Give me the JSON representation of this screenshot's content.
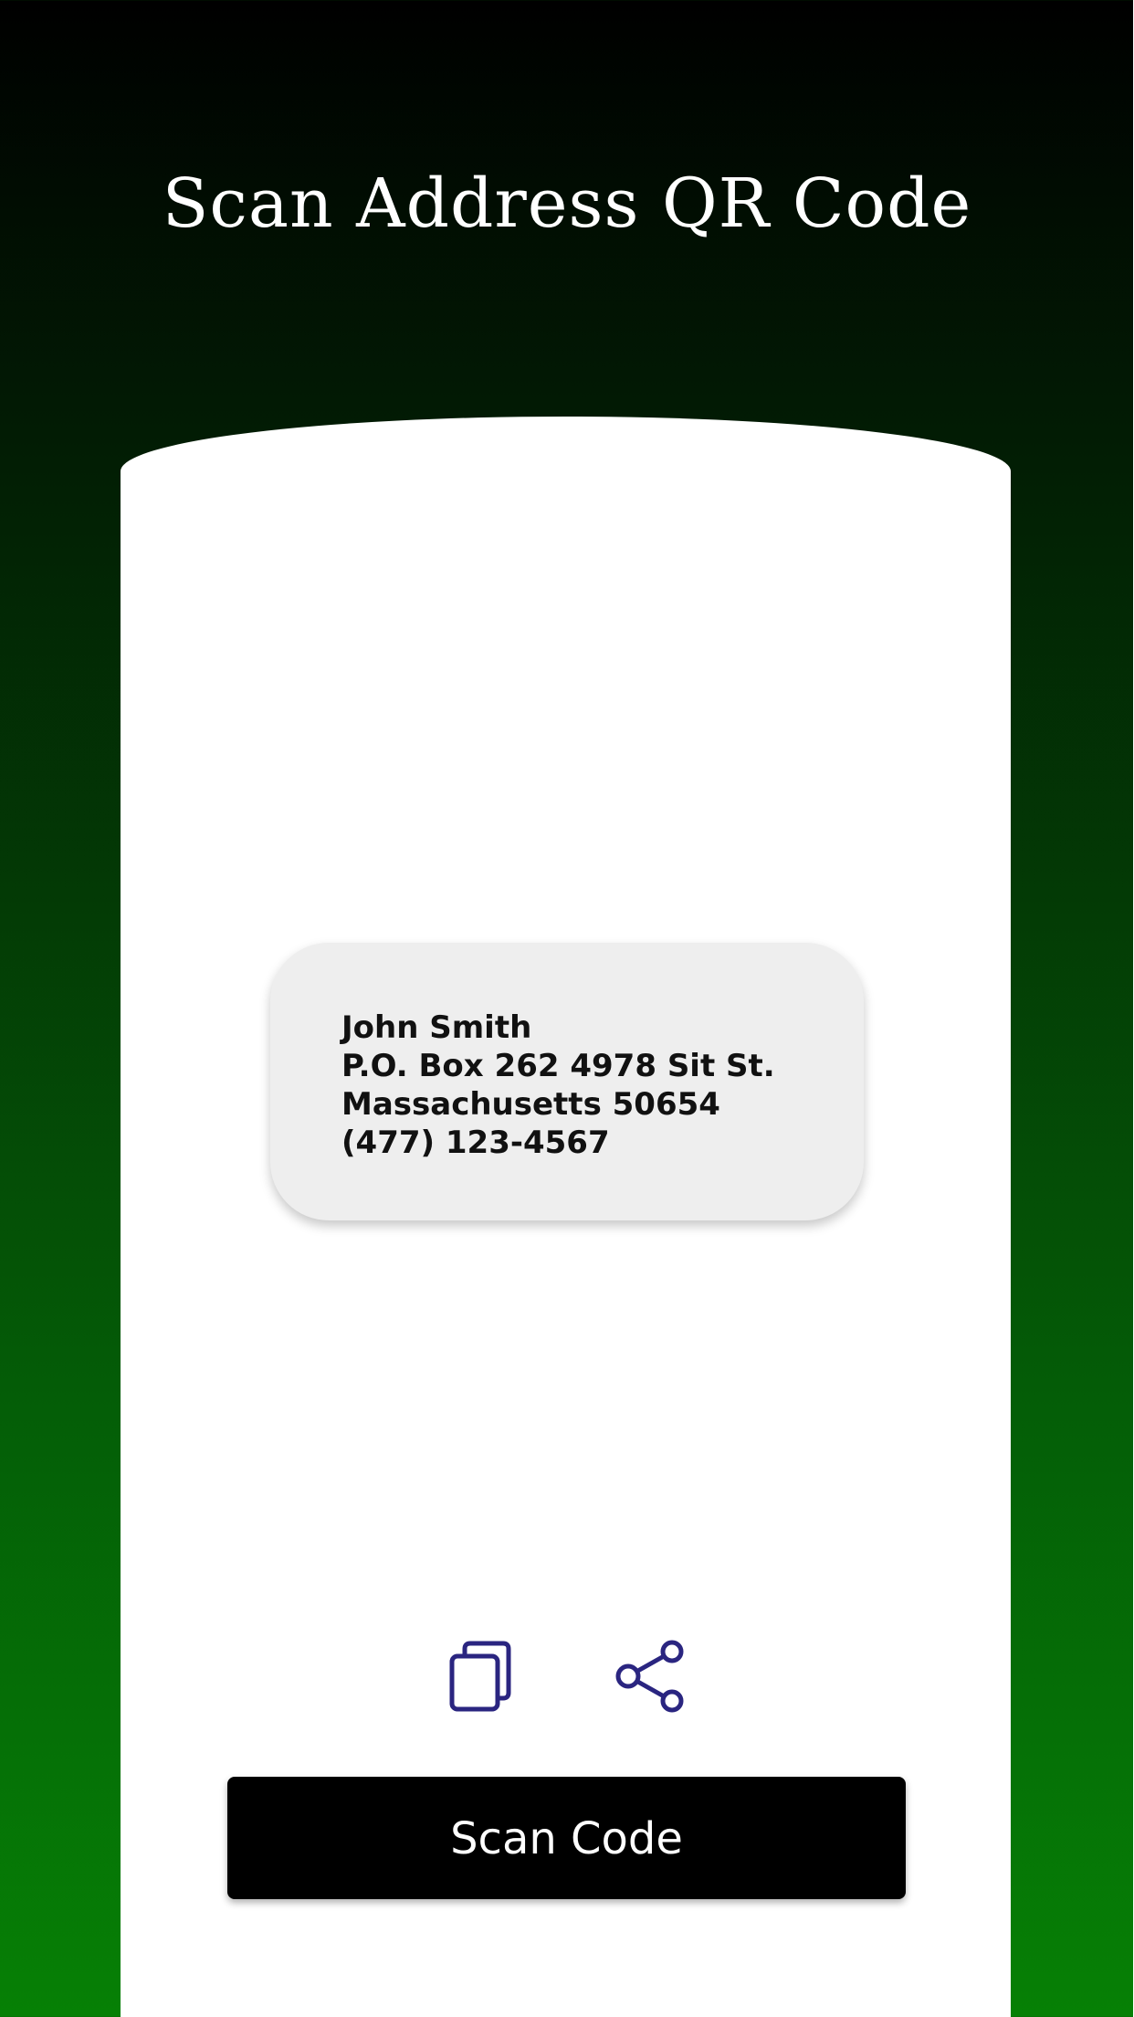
{
  "header": {
    "title": "Scan Address QR Code"
  },
  "result": {
    "lines": [
      "John Smith",
      "P.O. Box 262 4978 Sit St.",
      "Massachusetts 50654",
      "(477) 123-4567"
    ]
  },
  "actions": {
    "copy_icon": "copy-icon",
    "share_icon": "share-icon",
    "icon_color": "#2a2580"
  },
  "scan_button": {
    "label": "Scan Code"
  },
  "colors": {
    "gradient_top": "#000000",
    "gradient_bottom": "#068005",
    "card": "#ffffff",
    "result_box": "#eeeeee",
    "button": "#000000"
  }
}
